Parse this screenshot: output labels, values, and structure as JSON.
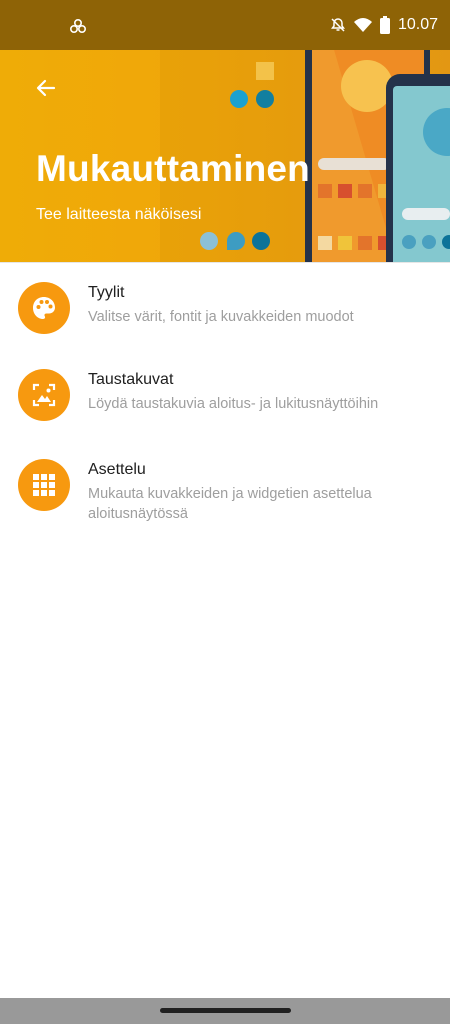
{
  "status_bar": {
    "time": "10.07",
    "icons": [
      "fan-icon",
      "alarm-off-icon",
      "wifi-icon",
      "battery-icon"
    ]
  },
  "header": {
    "title": "Mukauttaminen",
    "subtitle": "Tee laitteesta näköisesi",
    "back_icon": "arrow-back-icon",
    "colors": {
      "background": "#f0a60a",
      "text": "#ffffff"
    }
  },
  "list": {
    "accent_color": "#f7990f",
    "items": [
      {
        "title": "Tyylit",
        "description": "Valitse värit, fontit ja kuvakkeiden muodot",
        "icon": "palette-icon"
      },
      {
        "title": "Taustakuvat",
        "description": "Löydä taustakuvia aloitus- ja lukitusnäyttöihin",
        "icon": "wallpaper-icon"
      },
      {
        "title": "Asettelu",
        "description": "Mukauta kuvakkeiden ja widgetien asettelua aloitusnäytössä",
        "icon": "grid-icon"
      }
    ]
  }
}
